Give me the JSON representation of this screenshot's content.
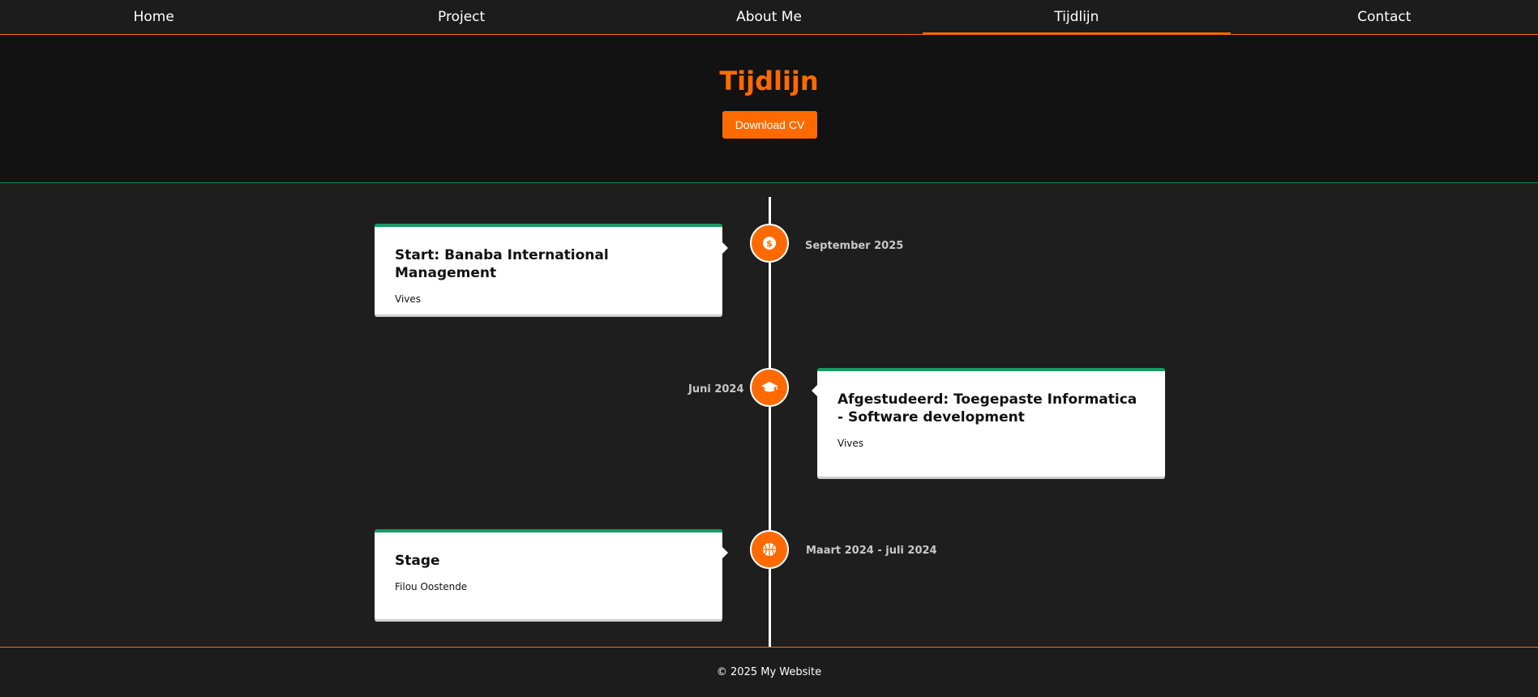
{
  "nav": {
    "items": [
      {
        "label": "Home"
      },
      {
        "label": "Project"
      },
      {
        "label": "About Me"
      },
      {
        "label": "Tijdlijn"
      },
      {
        "label": "Contact"
      }
    ],
    "active": "Tijdlijn"
  },
  "hero": {
    "title": "Tijdlijn",
    "button_label": "Download CV"
  },
  "timeline": {
    "events": [
      {
        "title": "Start: Banaba International Management",
        "subtitle": "Vives",
        "date": "September 2025",
        "icon": "dollar-icon"
      },
      {
        "title": "Afgestudeerd: Toegepaste Informatica - Software development",
        "subtitle": "Vives",
        "date": "Juni 2024",
        "icon": "graduation-cap-icon"
      },
      {
        "title": "Stage",
        "subtitle": "Filou Oostende",
        "date": "Maart 2024 - juli 2024",
        "icon": "basketball-icon"
      }
    ]
  },
  "footer": {
    "text": "© 2025 My Website"
  },
  "colors": {
    "accent": "#ff6a00",
    "green": "#1a9a62",
    "background": "#1e1e1e"
  }
}
